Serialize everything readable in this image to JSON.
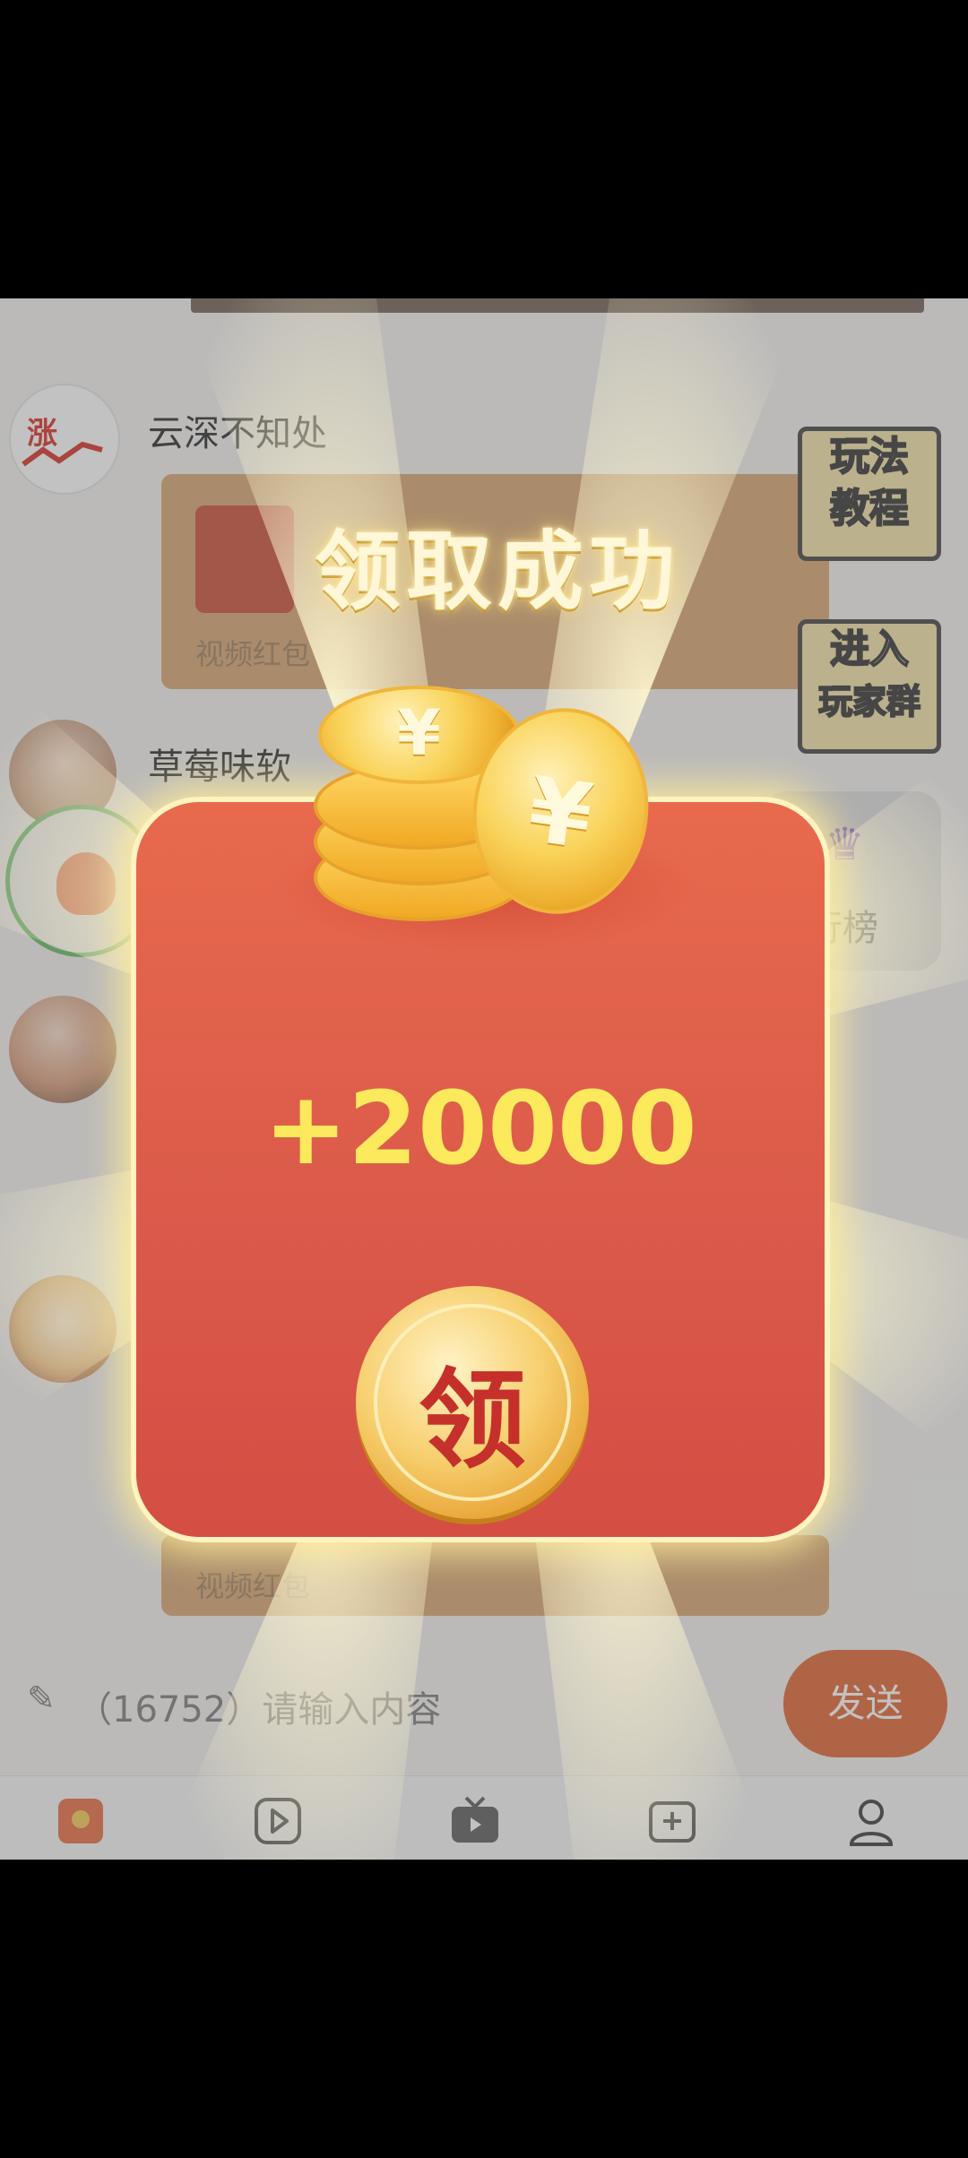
{
  "chat": {
    "messages": [
      {
        "avatar_label": "涨",
        "name": "云深不知处"
      },
      {
        "name": "草莓味软"
      }
    ],
    "redpacket_label": "视频红包",
    "redpacket_label_2": "视频红包"
  },
  "side_buttons": {
    "tutorial": [
      "玩法",
      "教程"
    ],
    "join_group": [
      "进入",
      "玩家群"
    ]
  },
  "ranking": {
    "icon": "crown-icon",
    "label": "行榜"
  },
  "input": {
    "placeholder": "（16752）请输入内容",
    "send_label": "发送"
  },
  "tabbar": {
    "icons": [
      "home-icon",
      "video-icon",
      "tv-icon",
      "add-photo-icon",
      "profile-icon"
    ]
  },
  "popup": {
    "title": "领取成功",
    "coin_symbol": "¥",
    "amount": "+20000",
    "claim_label": "领"
  },
  "colors": {
    "accent": "#e05d2a",
    "card": "#db5a4a",
    "gold": "#f7cf6e",
    "amount": "#fcea5c"
  }
}
